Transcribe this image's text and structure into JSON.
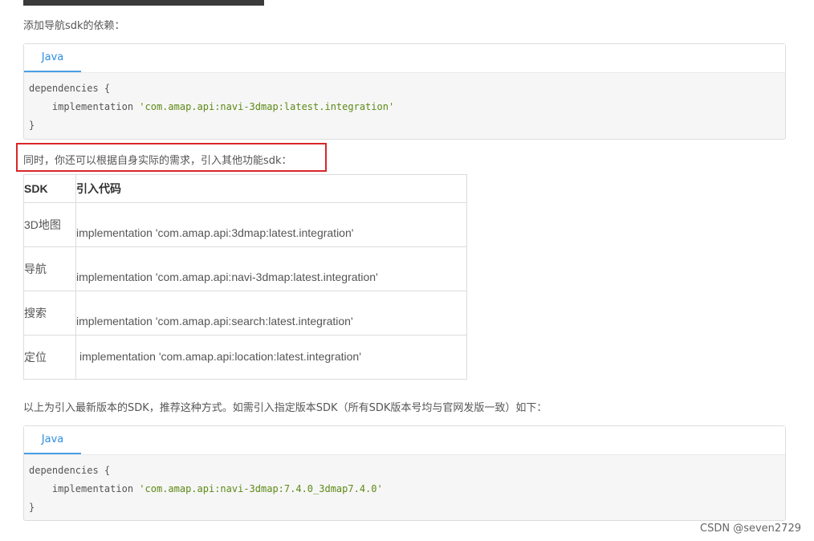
{
  "intro_text": "添加导航sdk的依赖：",
  "code_block_1": {
    "tab_label": "Java",
    "line1": "dependencies {",
    "line2_prefix": "    implementation ",
    "line2_string": "'com.amap.api:navi-3dmap:latest.integration'",
    "line3": "}"
  },
  "highlight_text": "同时，你还可以根据自身实际的需求，引入其他功能sdk：",
  "sdk_table": {
    "headers": [
      "SDK",
      "引入代码"
    ],
    "rows": [
      {
        "sdk": "3D地图",
        "code": "implementation 'com.amap.api:3dmap:latest.integration'"
      },
      {
        "sdk": "导航",
        "code": "implementation 'com.amap.api:navi-3dmap:latest.integration'"
      },
      {
        "sdk": "搜索",
        "code": "implementation 'com.amap.api:search:latest.integration'"
      },
      {
        "sdk": "定位",
        "code": "implementation 'com.amap.api:location:latest.integration'"
      }
    ]
  },
  "version_text": "以上为引入最新版本的SDK，推荐这种方式。如需引入指定版本SDK（所有SDK版本号均与官网发版一致）如下：",
  "code_block_2": {
    "tab_label": "Java",
    "line1": "dependencies {",
    "line2_prefix": "    implementation ",
    "line2_string": "'com.amap.api:navi-3dmap:7.4.0_3dmap7.4.0'",
    "line3": "}"
  },
  "watermark": "CSDN @seven2729",
  "colors": {
    "accent": "#2f8ee0",
    "string": "#5d8a16",
    "highlight_border": "#d9262a"
  }
}
